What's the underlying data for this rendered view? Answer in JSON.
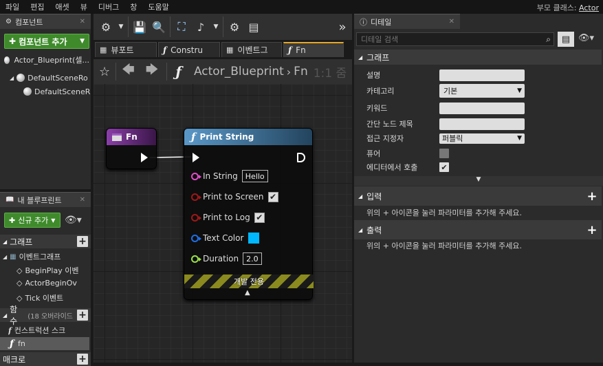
{
  "menu": [
    "파일",
    "편집",
    "애셋",
    "뷰",
    "디버그",
    "창",
    "도움말"
  ],
  "parent_class": {
    "label": "부모 클래스:",
    "value": "Actor"
  },
  "components": {
    "tab": "컴포넌트",
    "add_button": "컴포넌트 추가",
    "root": "Actor_Blueprint(셀...",
    "items": [
      "DefaultSceneRo",
      "DefaultSceneR"
    ]
  },
  "my_blueprint": {
    "tab": "내 블루프린트",
    "add_new": "신규 추가",
    "graph_section": "그래프",
    "event_graph": "이벤트그래프",
    "events": [
      "BeginPlay 이벤",
      "ActorBeginOv",
      "Tick 이벤트"
    ],
    "functions_section": "함수",
    "functions_override": "(18 오버라이드",
    "functions": [
      "컨스트럭션 스크",
      "fn"
    ],
    "macros_section": "매크로"
  },
  "editor_tabs": [
    {
      "label": "뷰포트"
    },
    {
      "label": "Constru"
    },
    {
      "label": "이벤트그"
    },
    {
      "label": "Fn"
    }
  ],
  "breadcrumb": {
    "blueprint": "Actor_Blueprint",
    "function": "Fn",
    "zoom": "1:1 줌"
  },
  "nodes": {
    "entry": {
      "title": "Fn"
    },
    "print": {
      "title": "Print String",
      "pins": [
        {
          "label": "In String",
          "value": "Hello",
          "color": "#e04ec8"
        },
        {
          "label": "Print to Screen",
          "checked": true,
          "color": "#a01818"
        },
        {
          "label": "Print to Log",
          "checked": true,
          "color": "#a01818"
        },
        {
          "label": "Text Color",
          "swatch": "#00b8ff",
          "color": "#1e6fe8"
        },
        {
          "label": "Duration",
          "value": "2.0",
          "color": "#9be04a"
        }
      ],
      "dev_only": "개발 전용"
    }
  },
  "details": {
    "tab": "디테일",
    "search_placeholder": "디테일 검색",
    "graph_section": "그래프",
    "fields": {
      "desc": "설명",
      "category": "카테고리",
      "category_value": "기본",
      "keywords": "키워드",
      "compact": "간단 노드 제목",
      "access": "접근 지정자",
      "access_value": "퍼블릭",
      "pure": "퓨어",
      "call_in_editor": "에디터에서 호출"
    },
    "inputs_section": "입력",
    "inputs_hint": "위의 + 아이콘을 눌러 파라미터를 추가해 주세요.",
    "outputs_section": "출력",
    "outputs_hint": "위의 + 아이콘을 눌러 파라미터를 추가해 주세요."
  }
}
